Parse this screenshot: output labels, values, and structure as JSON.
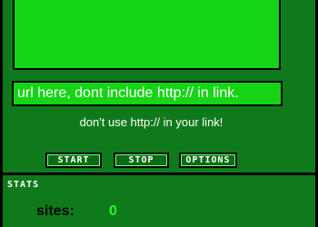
{
  "url_field": {
    "value": "url here, dont include http:// in link."
  },
  "note": "don't use http:// in your link!",
  "buttons": {
    "start": "START",
    "stop": "STOP",
    "options": "OPTIONS"
  },
  "stats": {
    "title": "STATS",
    "sites_label": "sites:",
    "sites_value": "0"
  },
  "colors": {
    "background": "#0f7a1b",
    "panel": "#16d416",
    "value_green": "#22ff22"
  }
}
